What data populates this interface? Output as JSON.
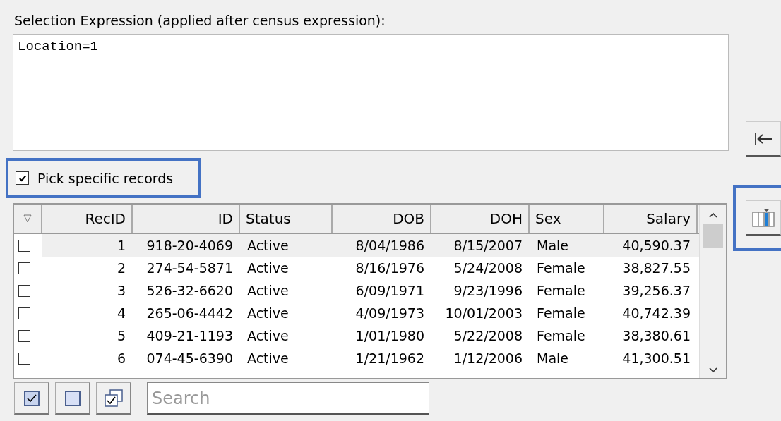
{
  "expression_label": "Selection Expression (applied after census expression):",
  "expression": {
    "value": "Location=1"
  },
  "pick_specific": {
    "label": "Pick specific records",
    "checked": true,
    "highlighted": true
  },
  "table": {
    "columns": [
      {
        "label": "RecID"
      },
      {
        "label": "ID"
      },
      {
        "label": "Status"
      },
      {
        "label": "DOB"
      },
      {
        "label": "DOH"
      },
      {
        "label": "Sex"
      },
      {
        "label": "Salary"
      }
    ],
    "rows": [
      {
        "checked": false,
        "selected": true,
        "cells": [
          "1",
          "918-20-4069",
          "Active",
          "8/04/1986",
          "8/15/2007",
          "Male",
          "40,590.37"
        ]
      },
      {
        "checked": false,
        "selected": false,
        "cells": [
          "2",
          "274-54-5871",
          "Active",
          "8/16/1976",
          "5/24/2008",
          "Female",
          "38,827.55"
        ]
      },
      {
        "checked": false,
        "selected": false,
        "cells": [
          "3",
          "526-32-6620",
          "Active",
          "6/09/1971",
          "9/23/1996",
          "Female",
          "39,256.37"
        ]
      },
      {
        "checked": false,
        "selected": false,
        "cells": [
          "4",
          "265-06-4442",
          "Active",
          "4/09/1973",
          "10/01/2003",
          "Female",
          "40,742.39"
        ]
      },
      {
        "checked": false,
        "selected": false,
        "cells": [
          "5",
          "409-21-1193",
          "Active",
          "1/01/1980",
          "5/22/2008",
          "Female",
          "38,380.61"
        ]
      },
      {
        "checked": false,
        "selected": false,
        "cells": [
          "6",
          "074-45-6390",
          "Active",
          "1/21/1962",
          "1/12/2006",
          "Male",
          "41,300.51"
        ]
      }
    ]
  },
  "search": {
    "placeholder": "Search"
  },
  "columns_button": {
    "highlighted": true
  }
}
